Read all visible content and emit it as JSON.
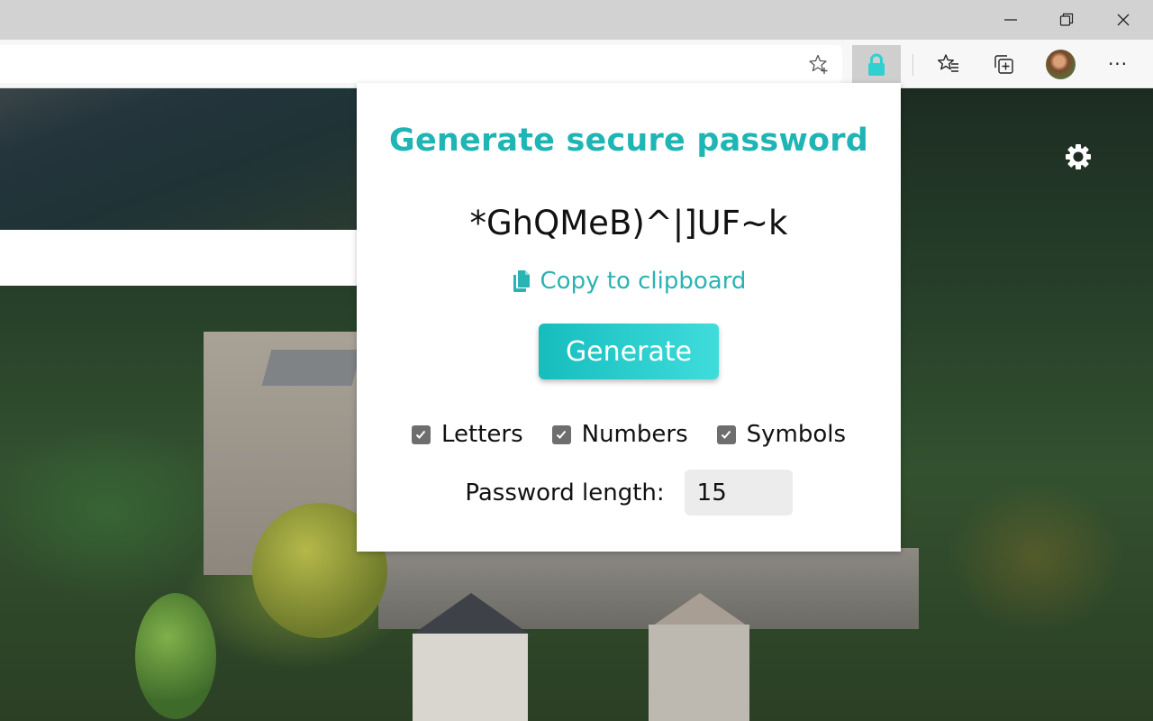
{
  "window": {
    "controls": {
      "minimize_icon": "minimize-icon",
      "restore_icon": "restore-icon",
      "close_icon": "close-icon"
    }
  },
  "toolbar": {
    "address_value": "",
    "add_favorite_icon": "star-plus-icon",
    "extension_icon": "lock-icon",
    "favorites_icon": "favorites-list-icon",
    "collections_icon": "collections-icon",
    "profile_icon": "avatar",
    "more_label": "···"
  },
  "page": {
    "settings_icon": "gear-icon"
  },
  "popup": {
    "title": "Generate secure password",
    "password": "*GhQMeB)^|]UF~k",
    "copy_label": "Copy to clipboard",
    "copy_icon": "copy-icon",
    "generate_label": "Generate",
    "options": [
      {
        "label": "Letters",
        "checked": true
      },
      {
        "label": "Numbers",
        "checked": true
      },
      {
        "label": "Symbols",
        "checked": true
      }
    ],
    "length_label": "Password length:",
    "length_value": "15"
  },
  "colors": {
    "accent": "#1fb5b5",
    "button_gradient_start": "#16bdbd",
    "button_gradient_end": "#40dcdc",
    "extension_lock": "#2fd0d0"
  }
}
